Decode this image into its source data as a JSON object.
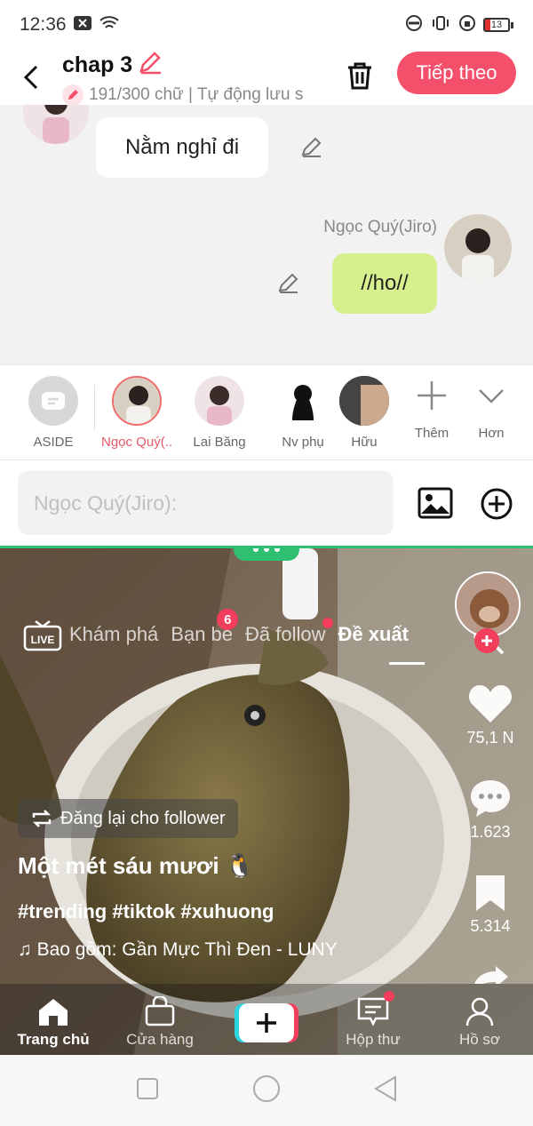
{
  "status": {
    "time": "12:36",
    "battery": "13"
  },
  "header": {
    "title": "chap 3",
    "subtitle": "191/300 chữ | Tự động lưu s",
    "next_label": "Tiếp theo"
  },
  "chat": {
    "messages": [
      {
        "text": "Nằm nghỉ đi",
        "side": "left"
      },
      {
        "speaker": "Ngọc Quý(Jiro)",
        "text": "//ho//",
        "side": "right"
      }
    ]
  },
  "characters": {
    "items": [
      {
        "label": "ASIDE"
      },
      {
        "label": "Ngọc Quý(..."
      },
      {
        "label": "Lai Băng"
      },
      {
        "label": "Nv phụ"
      },
      {
        "label": "Hữu"
      }
    ],
    "add_label": "Thêm",
    "more_label": "Hơn"
  },
  "composer": {
    "placeholder": "Ngọc Quý(Jiro):"
  },
  "feed": {
    "live_label": "LIVE",
    "tabs": [
      {
        "label": "Khám phá"
      },
      {
        "label": "Bạn bè",
        "badge": "6"
      },
      {
        "label": "Đã follow"
      },
      {
        "label": "Đề xuất"
      }
    ],
    "likes": "75,1 N",
    "comments": "1.623",
    "bookmarks": "5.314",
    "repost_label": "Đăng lại cho follower",
    "title": "Một mét sáu mươi 🐧",
    "tags": "#trending #tiktok #xuhuong",
    "music": "♫ Bao gồm: Gần Mực Thì Đen - LUNY"
  },
  "bottom_nav": [
    {
      "label": "Trang chủ"
    },
    {
      "label": "Cửa hàng"
    },
    {
      "label": ""
    },
    {
      "label": "Hộp thư"
    },
    {
      "label": "Hồ sơ"
    }
  ],
  "colors": {
    "accent": "#f4506c",
    "bubble_mine": "#d6f08e",
    "handle": "#2fbf72"
  }
}
